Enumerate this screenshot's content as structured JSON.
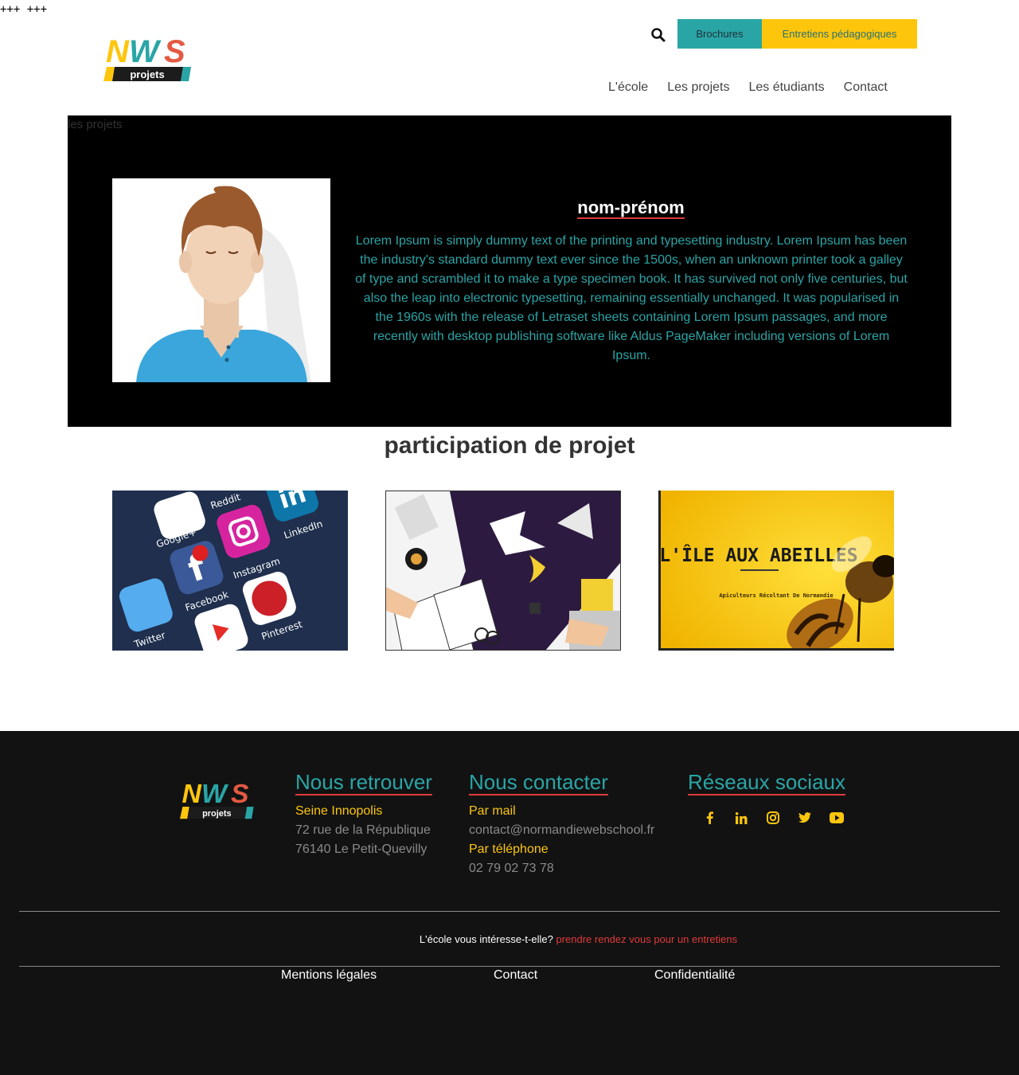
{
  "topmark": "+++ +++",
  "header": {
    "logo": {
      "text_top": "NWS",
      "text_bottom": "projets"
    },
    "search_icon": "search-icon",
    "brochures_label": "Brochures",
    "entretiens_label": "Entretiens pédagogiques",
    "nav": [
      "L'école",
      "Les projets",
      "Les étudiants",
      "Contact"
    ]
  },
  "hero": {
    "breadcrumb": "les projets",
    "name": "nom-prénom",
    "bio": "Lorem Ipsum is simply dummy text of the printing and typesetting industry. Lorem Ipsum has been the industry's standard dummy text ever since the 1500s, when an unknown printer took a galley of type and scrambled it to make a type specimen book. It has survived not only five centuries, but also the leap into electronic typesetting, remaining essentially unchanged. It was popularised in the 1960s with the release of Letraset sheets containing Lorem Ipsum passages, and more recently with desktop publishing software like Aldus PageMaker including versions of Lorem Ipsum."
  },
  "participation": {
    "title": "participation de projet",
    "cards": [
      {
        "icon": "social-media-apps-image",
        "labels": [
          "Google+",
          "Reddit",
          "Instagram",
          "LinkedIn",
          "Facebook",
          "Twitter",
          "Pinterest"
        ]
      },
      {
        "icon": "design-workspace-image",
        "labels": []
      },
      {
        "icon": "bee-image",
        "title": "L'ÎLE AUX ABEILLES",
        "subtitle": "Apiculteurs Récoltant De Normandie"
      }
    ]
  },
  "footer": {
    "logo": {
      "text_top": "NWS",
      "text_bottom": "projets"
    },
    "retrouver": {
      "title": "Nous retrouver",
      "place": "Seine Innopolis",
      "street": "72 rue de la République",
      "city": "76140 Le Petit-Quevilly"
    },
    "contacter": {
      "title": "Nous contacter",
      "mail_label": "Par mail",
      "mail": "contact@normandiewebschool.fr",
      "phone_label": "Par téléphone",
      "phone": "02 79 02 73 78"
    },
    "reseaux": {
      "title": "Réseaux sociaux",
      "icons": [
        "facebook-icon",
        "linkedin-icon",
        "instagram-icon",
        "twitter-icon",
        "youtube-icon"
      ]
    },
    "cta_text": "L'école vous intéresse-t-elle?",
    "cta_link": "prendre rendez vous pour un entretiens",
    "links": [
      "Mentions légales",
      "Contact",
      "Confidentialité"
    ]
  },
  "colors": {
    "teal": "#2aa5a6",
    "yellow": "#fdc60d",
    "red": "#e03a3a",
    "footer_bg": "#121212"
  }
}
